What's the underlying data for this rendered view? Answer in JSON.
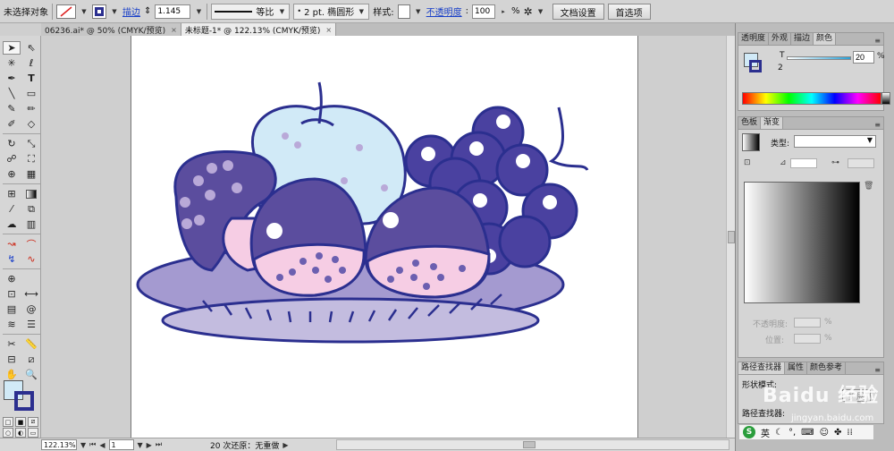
{
  "control_bar": {
    "selection_status": "未选择对象",
    "stroke_link": "描边",
    "stroke_weight": "1.145",
    "profile_label": "等比",
    "brush_label": "2 pt. 椭圆形",
    "style_label": "样式:",
    "opacity_link": "不透明度",
    "opacity_value": "100",
    "opacity_unit": "%",
    "doc_setup_button": "文档设置",
    "preferences_button": "首选项"
  },
  "tabs": [
    {
      "label": "06236.ai* @ 50% (CMYK/预览)",
      "close": "×"
    },
    {
      "label": "未标题-1* @ 122.13% (CMYK/预览)",
      "close": "×"
    }
  ],
  "status_bar": {
    "zoom": "122.13%",
    "artboard": "1",
    "undo_text": "20 次还原：无重做"
  },
  "panels": {
    "color_tabs": [
      "透明度",
      "外观",
      "描边",
      "颜色"
    ],
    "color_t_label": "T",
    "color_t_value": "20",
    "color_t_unit": "%",
    "color_t_number": "2",
    "gradient_tabs": [
      "色板",
      "渐变"
    ],
    "gradient_type_label": "类型:",
    "gradient_opacity_label": "不透明度:",
    "gradient_location_label": "位置:",
    "pct": "%",
    "bottom_tabs": [
      "路径查找器",
      "属性",
      "颜色参考"
    ],
    "shape_mode_label": "形状模式:",
    "pathfinder_label": "路径查找器:",
    "expand_button": "扩展",
    "watermark": "Baidu 经验",
    "watermark_url": "jingyan.baidu.com",
    "ime_label": "英"
  },
  "colors": {
    "fill": "#d1eaf7",
    "stroke": "#2b2f8f",
    "plate": "#a49ad0",
    "plum": "#5b4d9e",
    "grape": "#4a41a0",
    "pink": "#f6cde4",
    "apple": "#d1eaf7"
  },
  "icons": [
    "selection-tool-icon",
    "direct-selection-tool-icon",
    "magic-wand-icon",
    "lasso-icon",
    "pen-tool-icon",
    "type-tool-icon",
    "line-tool-icon",
    "rectangle-tool-icon",
    "paintbrush-icon",
    "pencil-icon",
    "blob-brush-icon",
    "eraser-icon",
    "rotate-icon",
    "scale-icon",
    "warp-icon",
    "free-transform-icon",
    "shape-builder-icon",
    "perspective-grid-icon",
    "mesh-icon",
    "gradient-tool-icon",
    "eyedropper-icon",
    "blend-icon",
    "symbol-sprayer-icon",
    "graph-icon",
    "artboard-tool-icon",
    "slice-icon",
    "hand-icon",
    "zoom-icon"
  ]
}
